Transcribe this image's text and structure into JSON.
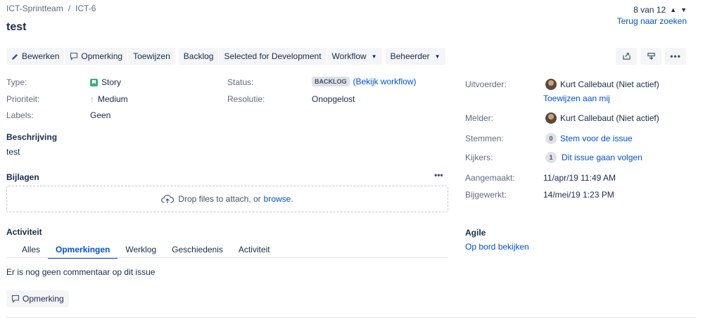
{
  "breadcrumb": {
    "project": "ICT-Sprintteam",
    "separator": "/",
    "issue_key": "ICT-6"
  },
  "issue": {
    "title": "test"
  },
  "pager": {
    "text": "8 van 12",
    "back_label": "Terug naar zoeken"
  },
  "toolbar": {
    "edit": "Bewerken",
    "comment": "Opmerking",
    "assign": "Toewijzen",
    "backlog": "Backlog",
    "selected": "Selected for Development",
    "workflow": "Workflow",
    "admin": "Beheerder"
  },
  "details": {
    "type_label": "Type:",
    "type_value": "Story",
    "priority_label": "Prioriteit:",
    "priority_value": "Medium",
    "labels_label": "Labels:",
    "labels_value": "Geen",
    "status_label": "Status:",
    "status_value": "BACKLOG",
    "status_link": "(Bekijk workflow)",
    "resolution_label": "Resolutie:",
    "resolution_value": "Onopgelost"
  },
  "description": {
    "heading": "Beschrijving",
    "text": "test"
  },
  "attachments": {
    "heading": "Bijlagen",
    "drop_text": "Drop files to attach, or",
    "browse": "browse."
  },
  "activity": {
    "heading": "Activiteit",
    "tabs": [
      "Alles",
      "Opmerkingen",
      "Werklog",
      "Geschiedenis",
      "Activiteit"
    ],
    "active_tab": "Opmerkingen",
    "empty_text": "Er is nog geen commentaar op dit issue",
    "comment_button": "Opmerking"
  },
  "people": {
    "assignee_label": "Uitvoerder:",
    "assignee_name": "Kurt Callebaut (Niet actief)",
    "assign_me": "Toewijzen aan mij",
    "reporter_label": "Melder:",
    "reporter_name": "Kurt Callebaut (Niet actief)",
    "votes_label": "Stemmen:",
    "votes_count": "0",
    "votes_link": "Stem voor de issue",
    "watchers_label": "Kijkers:",
    "watchers_count": "1",
    "watchers_link": "Dit issue gaan volgen"
  },
  "dates": {
    "created_label": "Aangemaakt:",
    "created_value": "11/apr/19 11:49 AM",
    "updated_label": "Bijgewerkt:",
    "updated_value": "14/mei/19 1:23 PM"
  },
  "agile": {
    "heading": "Agile",
    "link": "Op bord bekijken"
  },
  "colors": {
    "link": "#0052cc",
    "story": "#36b37e",
    "priority_medium": "#f79232"
  }
}
